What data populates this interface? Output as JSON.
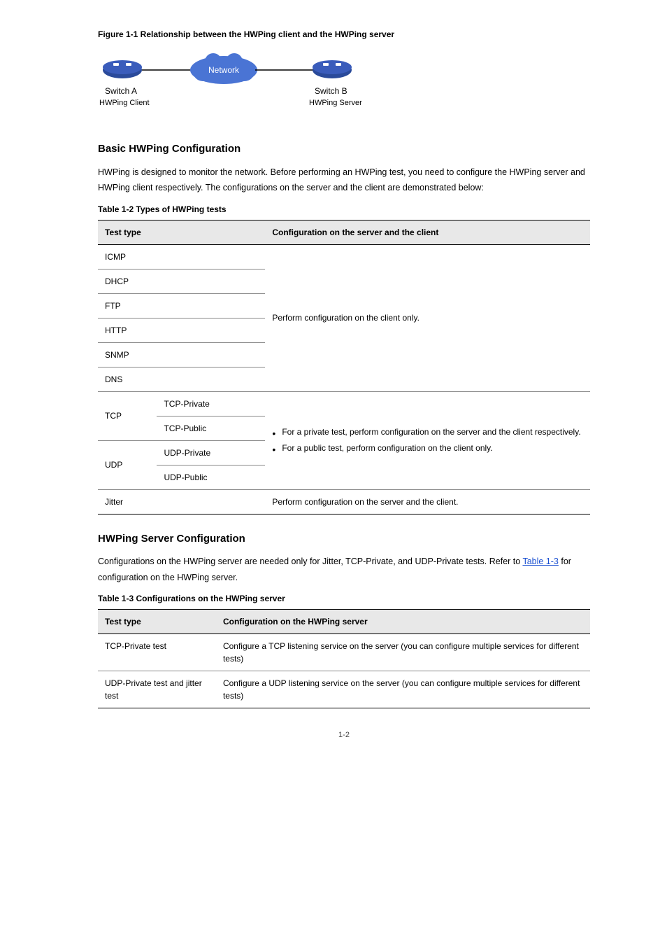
{
  "figure1": {
    "caption": "Figure 1-1 Relationship between the HWPing client and the HWPing server",
    "switchA": "Switch A",
    "clientA": "HWPing Client",
    "switchB": "Switch B",
    "serverB": "HWPing Server",
    "network": "Network"
  },
  "sec1": {
    "title": "Basic HWPing Configuration",
    "para": "HWPing is designed to monitor the network. Before performing an HWPing test, you need to configure the HWPing server and HWPing client respectively. The configurations on the server and the client are demonstrated below:"
  },
  "table1": {
    "caption": "Table 1-2 Types of HWPing tests",
    "headers": {
      "col1": "Test type",
      "col2": "Configuration on the server and the client"
    },
    "rows": [
      {
        "c1": "ICMP"
      },
      {
        "c1": "DHCP"
      },
      {
        "c1": "FTP"
      },
      {
        "c1": "HTTP"
      },
      {
        "c1": "SNMP"
      },
      {
        "c1": "DNS"
      },
      {
        "c1": "TCP-Private",
        "sub": "TCP"
      },
      {
        "c1": "TCP-Public"
      },
      {
        "c1": "UDP-Private",
        "sub": "UDP"
      },
      {
        "c1": "UDP-Public"
      },
      {
        "c1": "Jitter"
      }
    ],
    "right1": "Perform configuration on the client only.",
    "right2_items": [
      "For a private test, perform configuration on the server and the client respectively.",
      "For a public test, perform configuration on the client only."
    ],
    "right3": "Perform configuration on the server and the client."
  },
  "sec2": {
    "title": "HWPing Server Configuration",
    "paraPrefix": "Configurations on the HWPing server are needed only for Jitter, TCP-Private, and UDP-Private tests. Refer to ",
    "link": "Table 1-3",
    "paraSuffix": " for configuration on the HWPing server."
  },
  "table2": {
    "caption": "Table 1-3 Configurations on the HWPing server",
    "headers": {
      "col1": "Test type",
      "col2": "Configuration on the HWPing server"
    },
    "rows": [
      {
        "c1": "TCP-Private test",
        "c2": "Configure a TCP listening service on the server (you can configure multiple services for different tests)"
      },
      {
        "c1": "UDP-Private test and jitter test",
        "c2": "Configure a UDP listening service on the server (you can configure multiple services for different tests)"
      }
    ]
  },
  "pageNumber": "1-2"
}
